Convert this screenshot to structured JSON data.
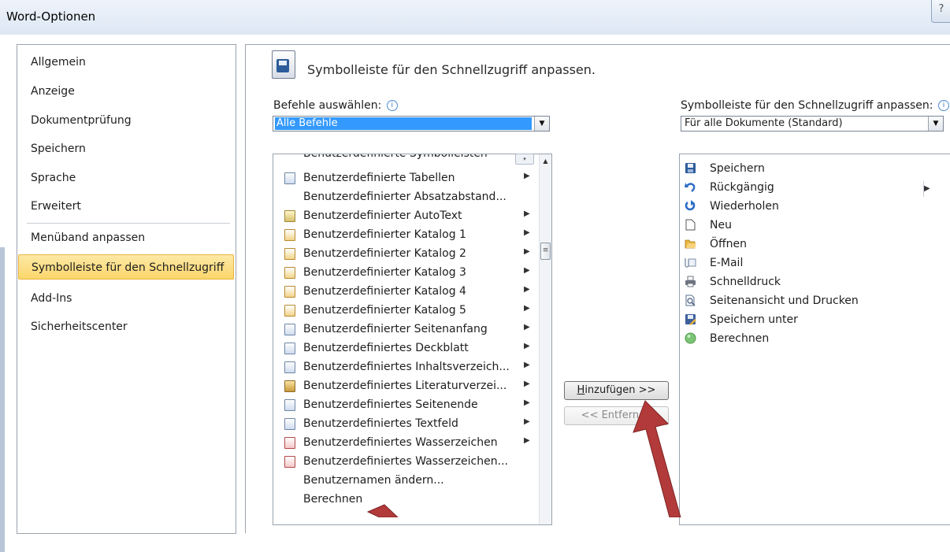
{
  "window": {
    "title": "Word-Optionen",
    "help_glyph": "?"
  },
  "sidebar": {
    "items": [
      {
        "label": "Allgemein"
      },
      {
        "label": "Anzeige"
      },
      {
        "label": "Dokumentprüfung"
      },
      {
        "label": "Speichern"
      },
      {
        "label": "Sprache"
      },
      {
        "label": "Erweitert"
      },
      {
        "label": "Menüband anpassen"
      },
      {
        "label": "Symbolleiste für den Schnellzugriff"
      },
      {
        "label": "Add-Ins"
      },
      {
        "label": "Sicherheitscenter"
      }
    ]
  },
  "main": {
    "header": "Symbolleiste für den Schnellzugriff anpassen.",
    "left_label": "Befehle auswählen:",
    "left_combo_value": "Alle Befehle",
    "right_label": "Symbolleiste für den Schnellzugriff anpassen:",
    "right_combo_value": "Für alle Dokumente (Standard)",
    "info_glyph": "i",
    "combo_arrow": "▼",
    "submenu_arrow": "▶",
    "scroll_up": "▲",
    "scroll_grip": "≡",
    "collapse_glyph": "▾"
  },
  "commands": [
    {
      "label": "Benutzerdefinierte Symbolleisten",
      "submenu": false
    },
    {
      "label": "Benutzerdefinierte Tabellen",
      "submenu": true
    },
    {
      "label": "Benutzerdefinierter Absatzabstand...",
      "submenu": false
    },
    {
      "label": "Benutzerdefinierter AutoText",
      "submenu": true
    },
    {
      "label": "Benutzerdefinierter Katalog 1",
      "submenu": true
    },
    {
      "label": "Benutzerdefinierter Katalog 2",
      "submenu": true
    },
    {
      "label": "Benutzerdefinierter Katalog 3",
      "submenu": true
    },
    {
      "label": "Benutzerdefinierter Katalog 4",
      "submenu": true
    },
    {
      "label": "Benutzerdefinierter Katalog 5",
      "submenu": true
    },
    {
      "label": "Benutzerdefinierter Seitenanfang",
      "submenu": true
    },
    {
      "label": "Benutzerdefiniertes Deckblatt",
      "submenu": true
    },
    {
      "label": "Benutzerdefiniertes Inhaltsverzeich...",
      "submenu": true
    },
    {
      "label": "Benutzerdefiniertes Literaturverzei...",
      "submenu": true
    },
    {
      "label": "Benutzerdefiniertes Seitenende",
      "submenu": true
    },
    {
      "label": "Benutzerdefiniertes Textfeld",
      "submenu": true
    },
    {
      "label": "Benutzerdefiniertes Wasserzeichen",
      "submenu": true
    },
    {
      "label": "Benutzerdefiniertes Wasserzeichen...",
      "submenu": false
    },
    {
      "label": "Benutzernamen ändern...",
      "submenu": false
    },
    {
      "label": "Berechnen",
      "submenu": false
    }
  ],
  "buttons": {
    "add_prefix": "H",
    "add_rest": "inzufügen >>",
    "remove": "<< Entfernen"
  },
  "toolbar_items": [
    {
      "label": "Speichern",
      "icon": "save-icon",
      "color": "#2d5c9a"
    },
    {
      "label": "Rückgängig",
      "icon": "undo-icon",
      "color": "#2b6cc4"
    },
    {
      "label": "Wiederholen",
      "icon": "redo-icon",
      "color": "#2b6cc4"
    },
    {
      "label": "Neu",
      "icon": "new-document-icon",
      "color": "#ffffff"
    },
    {
      "label": "Öffnen",
      "icon": "open-folder-icon",
      "color": "#e8b53c"
    },
    {
      "label": "E-Mail",
      "icon": "email-icon",
      "color": "#7b8ea8"
    },
    {
      "label": "Schnelldruck",
      "icon": "printer-icon",
      "color": "#6d7480"
    },
    {
      "label": "Seitenansicht und Drucken",
      "icon": "print-preview-icon",
      "color": "#5a6f8c"
    },
    {
      "label": "Speichern unter",
      "icon": "save-as-icon",
      "color": "#3d5f9c"
    },
    {
      "label": "Berechnen",
      "icon": "calculate-icon",
      "color": "#7cc576"
    }
  ],
  "colors": {
    "selection": "#3399ff",
    "nav_selected": "#fbd66b",
    "annotation_arrow": "#b33a3a"
  }
}
